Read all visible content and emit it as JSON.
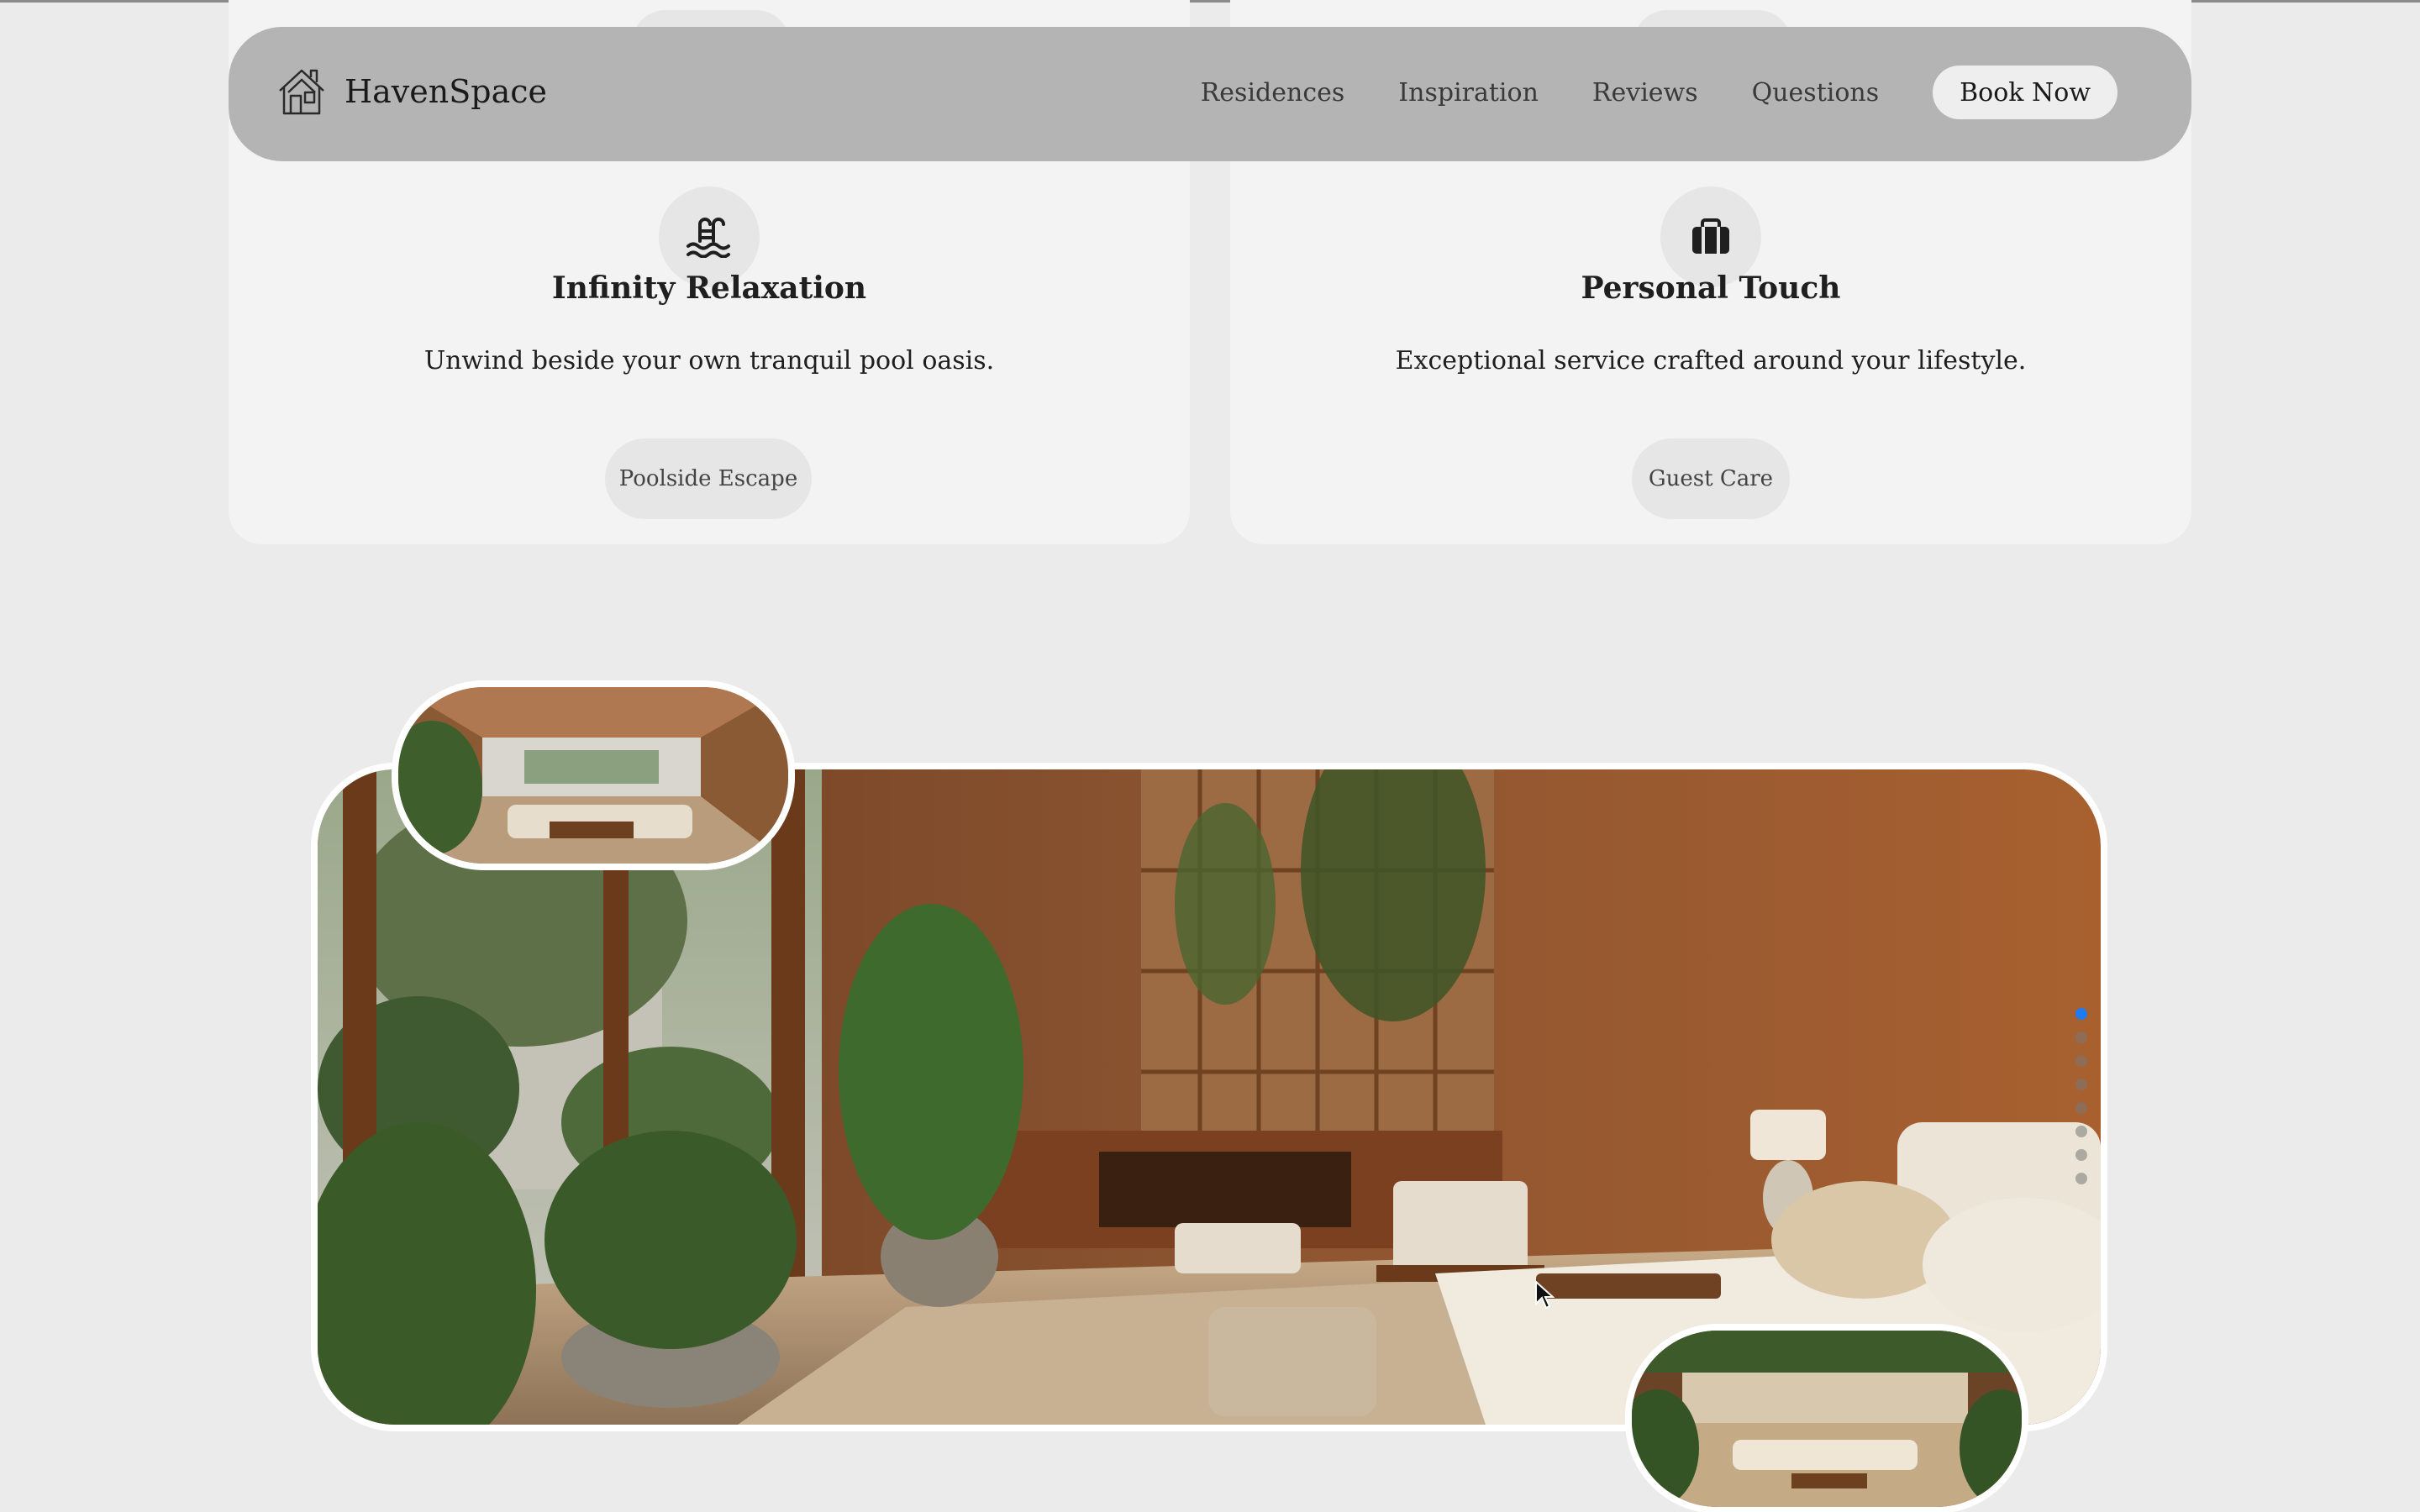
{
  "navbar": {
    "brand": "HavenSpace",
    "links": [
      "Residences",
      "Inspiration",
      "Reviews",
      "Questions"
    ],
    "cta": "Book Now"
  },
  "cards": [
    {
      "icon": "pool-swimmer-icon",
      "title": "Infinity Relaxation",
      "text": "Unwind beside your own tranquil pool oasis.",
      "pill": "Poolside Escape"
    },
    {
      "icon": "suitcase-icon",
      "title": "Personal Touch",
      "text": "Exceptional service crafted around your lifestyle.",
      "pill": "Guest Care"
    }
  ],
  "gallery": {
    "slide_count": 8,
    "active_slide": 1
  },
  "colors": {
    "accent": "#1e7bf0",
    "navbar": "#b4b4b4",
    "background": "#ebebeb",
    "card": "#f3f3f3"
  }
}
